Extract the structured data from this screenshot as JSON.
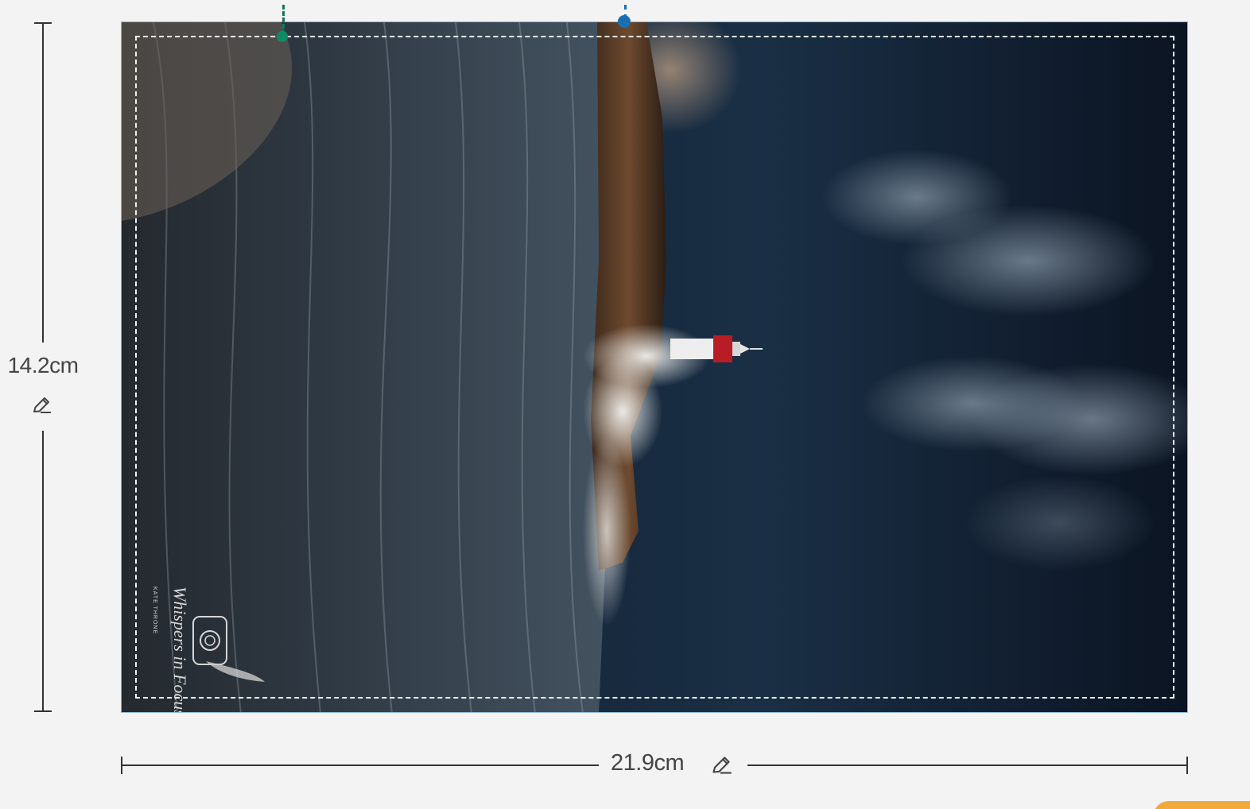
{
  "dimensions": {
    "height_label": "14.2cm",
    "width_label": "21.9cm"
  },
  "icons": {
    "edit": "pencil-icon"
  },
  "artwork": {
    "watermark_title": "Whispers in Focus",
    "watermark_subtitle": "KATE THRONE"
  },
  "colors": {
    "safe_area_border": "#eef3f3",
    "guide_green": "#0f8a62",
    "guide_blue": "#1a6fb4",
    "canvas_border": "#8fb6d6",
    "accent_orange": "#f3a93b",
    "lighthouse_red": "#b81d26"
  }
}
